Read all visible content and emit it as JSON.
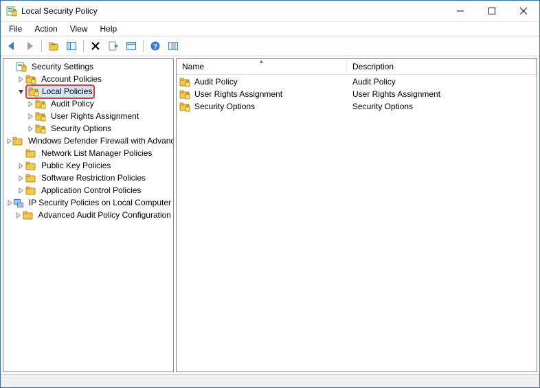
{
  "window": {
    "title": "Local Security Policy"
  },
  "menubar": {
    "items": [
      "File",
      "Action",
      "View",
      "Help"
    ]
  },
  "toolbar": {
    "icons": [
      "back",
      "forward",
      "up",
      "show-hide-tree",
      "delete",
      "export",
      "refresh",
      "help",
      "info"
    ]
  },
  "tree": {
    "root_label": "Security Settings",
    "nodes": [
      {
        "label": "Account Policies",
        "expanded": false,
        "icon": "folder-lock",
        "children_count": 1
      },
      {
        "label": "Local Policies",
        "expanded": true,
        "icon": "folder-lock",
        "highlight": true,
        "children": [
          {
            "label": "Audit Policy",
            "icon": "folder-lock"
          },
          {
            "label": "User Rights Assignment",
            "icon": "folder-lock"
          },
          {
            "label": "Security Options",
            "icon": "folder-lock"
          }
        ]
      },
      {
        "label": "Windows Defender Firewall with Advanced Security",
        "expanded": false,
        "icon": "folder",
        "children_count": 1
      },
      {
        "label": "Network List Manager Policies",
        "expanded": false,
        "icon": "folder",
        "children_count": 0
      },
      {
        "label": "Public Key Policies",
        "expanded": false,
        "icon": "folder",
        "children_count": 1
      },
      {
        "label": "Software Restriction Policies",
        "expanded": false,
        "icon": "folder",
        "children_count": 1
      },
      {
        "label": "Application Control Policies",
        "expanded": false,
        "icon": "folder",
        "children_count": 1
      },
      {
        "label": "IP Security Policies on Local Computer",
        "expanded": false,
        "icon": "ip",
        "children_count": 1
      },
      {
        "label": "Advanced Audit Policy Configuration",
        "expanded": false,
        "icon": "folder",
        "children_count": 1
      }
    ]
  },
  "list": {
    "columns": {
      "name": "Name",
      "description": "Description"
    },
    "rows": [
      {
        "name": "Audit Policy",
        "description": "Audit Policy",
        "icon": "folder-lock"
      },
      {
        "name": "User Rights Assignment",
        "description": "User Rights Assignment",
        "icon": "folder-lock"
      },
      {
        "name": "Security Options",
        "description": "Security Options",
        "icon": "folder-lock"
      }
    ]
  }
}
